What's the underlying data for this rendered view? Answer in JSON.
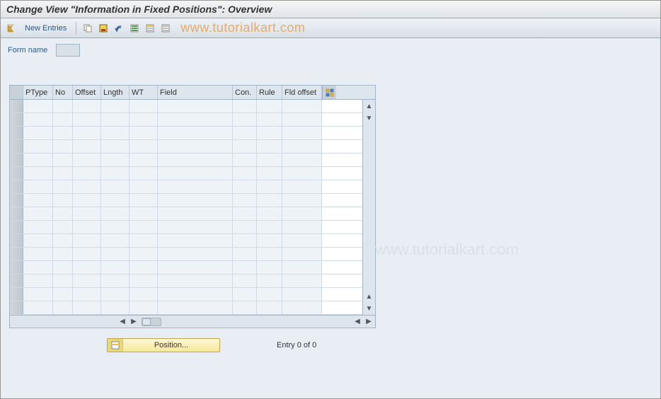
{
  "title": "Change View \"Information in Fixed Positions\": Overview",
  "toolbar": {
    "new_entries": "New Entries"
  },
  "form": {
    "name_label": "Form name",
    "name_value": ""
  },
  "table": {
    "columns": {
      "ptype": "PType",
      "no": "No",
      "offset": "Offset",
      "lngth": "Lngth",
      "wt": "WT",
      "field": "Field",
      "con": "Con.",
      "rule": "Rule",
      "fld_offset": "Fld offset"
    },
    "row_count": 16
  },
  "footer": {
    "position_btn": "Position...",
    "entry_text": "Entry 0 of 0"
  },
  "watermark": "www.tutorialkart.com"
}
